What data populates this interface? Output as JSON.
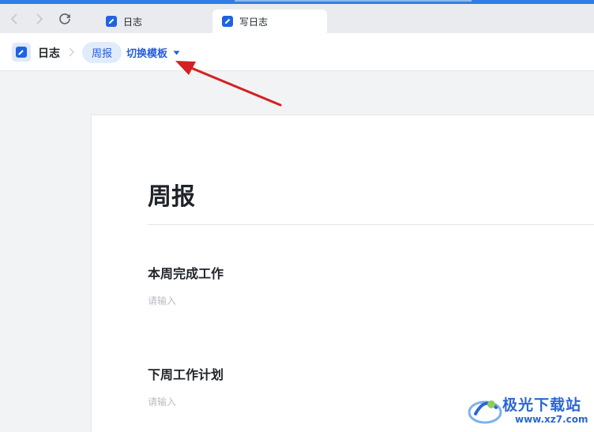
{
  "tabs": [
    {
      "label": "日志",
      "active": false
    },
    {
      "label": "写日志",
      "active": true
    }
  ],
  "header": {
    "app_name": "日志",
    "current_template": "周报",
    "switch_template_label": "切换模板"
  },
  "document": {
    "title": "周报",
    "sections": [
      {
        "heading": "本周完成工作",
        "placeholder": "请输入"
      },
      {
        "heading": "下周工作计划",
        "placeholder": "请输入"
      }
    ]
  },
  "watermark": {
    "brand": "极光下载站",
    "url": "www.xz7.com"
  },
  "colors": {
    "accent": "#245bdb",
    "pill_bg": "#e1ecfb",
    "annotation_arrow": "#d42020"
  }
}
